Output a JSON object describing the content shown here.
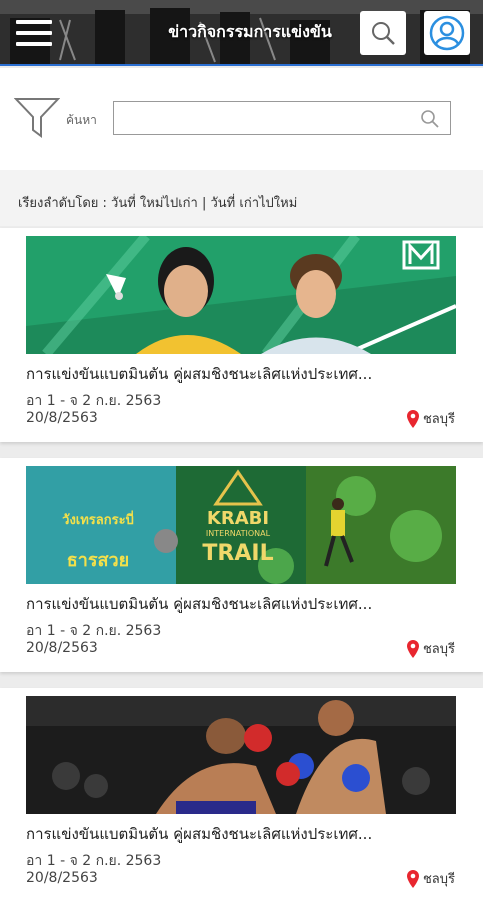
{
  "header": {
    "title": "ข่าวกิจกรรมการแข่งขัน",
    "menu_icon": "hamburger-menu-icon",
    "search_icon": "search-icon",
    "user_icon": "user-profile-icon",
    "accent_color": "#2b6fd1"
  },
  "search": {
    "filter_icon": "filter-funnel-icon",
    "label": "ค้นหา",
    "value": "",
    "placeholder": ""
  },
  "sort": {
    "prefix": "เรียงลำดับโดย :",
    "option_new_to_old": "วันที่ ใหม่ไปเก่า",
    "separator": "|",
    "option_old_to_new": "วันที่ เก่าไปใหม่"
  },
  "cards": [
    {
      "title": "การแข่งขันแบตมินตัน คู่ผสมชิงชนะเลิศแห่งประเทศ...",
      "date_range": "อา 1 - จ 2 ก.ย. 2563",
      "date": "20/8/2563",
      "location": "ชลบุรี",
      "banner_theme": "badminton"
    },
    {
      "title": "การแข่งขันแบตมินตัน คู่ผสมชิงชนะเลิศแห่งประเทศ...",
      "date_range": "อา 1 - จ 2 ก.ย. 2563",
      "date": "20/8/2563",
      "location": "ชลบุรี",
      "banner_theme": "trail-run",
      "banner_text": {
        "krabi": "KRABI",
        "international": "INTERNATIONAL",
        "trail": "TRAIL",
        "thai_headline": "วังเทรลกระบี่",
        "thai_sub": "ธารสวย"
      }
    },
    {
      "title": "การแข่งขันแบตมินตัน คู่ผสมชิงชนะเลิศแห่งประเทศ...",
      "date_range": "อา 1 - จ 2 ก.ย. 2563",
      "date": "20/8/2563",
      "location": "ชลบุรี",
      "banner_theme": "muay-thai"
    }
  ],
  "location_pin_color": "#e8262f"
}
